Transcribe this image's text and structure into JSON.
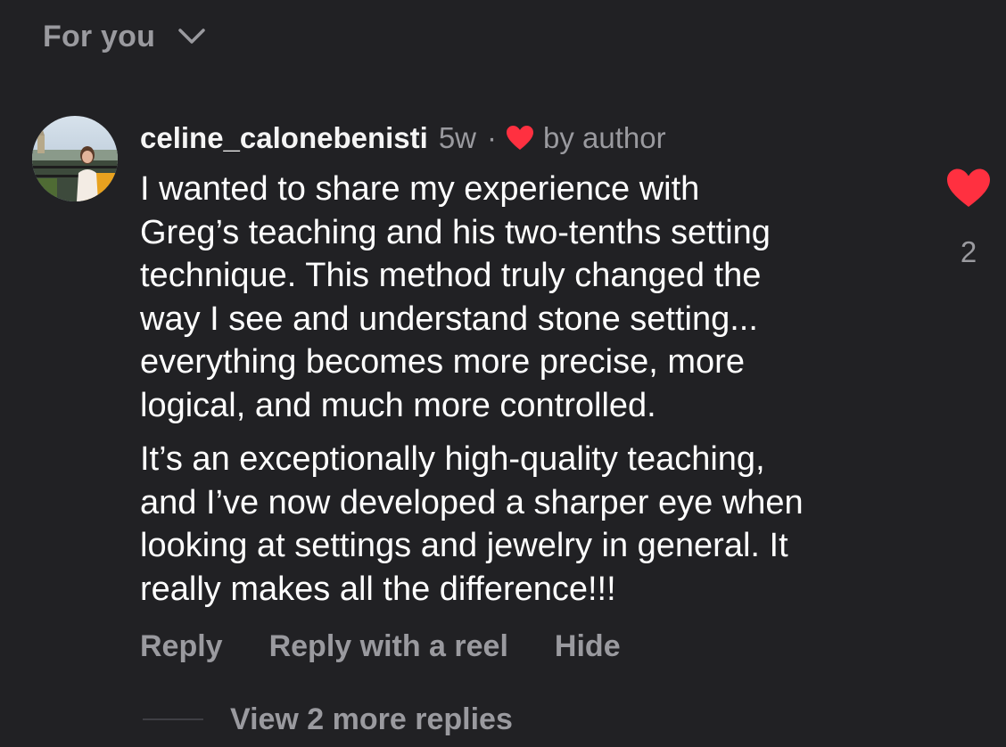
{
  "sort": {
    "label": "For you",
    "icon": "chevron-down-icon"
  },
  "comment": {
    "username": "celine_calonebenisti",
    "time": "5w",
    "separator": "·",
    "liked_by_author_label": "by author",
    "paragraphs": [
      [
        "I wanted to share my experience with",
        "Greg’s teaching and his two-tenths setting",
        "technique. This method truly changed the",
        "way I see and understand stone setting...",
        "everything becomes more precise, more",
        "logical, and much more controlled."
      ],
      [
        "It’s an exceptionally high-quality teaching,",
        "and I’ve now developed a sharper eye when",
        "looking at settings and jewelry in general. It",
        "really makes all the difference!!!"
      ]
    ],
    "actions": {
      "reply": "Reply",
      "reply_with_reel": "Reply with a reel",
      "hide": "Hide"
    },
    "like_count": "2",
    "view_replies": "View 2 more replies"
  },
  "colors": {
    "background": "#212124",
    "muted_text": "#9a9a9f",
    "heart_red": "#ff3040"
  },
  "icons": {
    "author_heart": "heart-filled-icon",
    "like": "heart-filled-icon"
  }
}
